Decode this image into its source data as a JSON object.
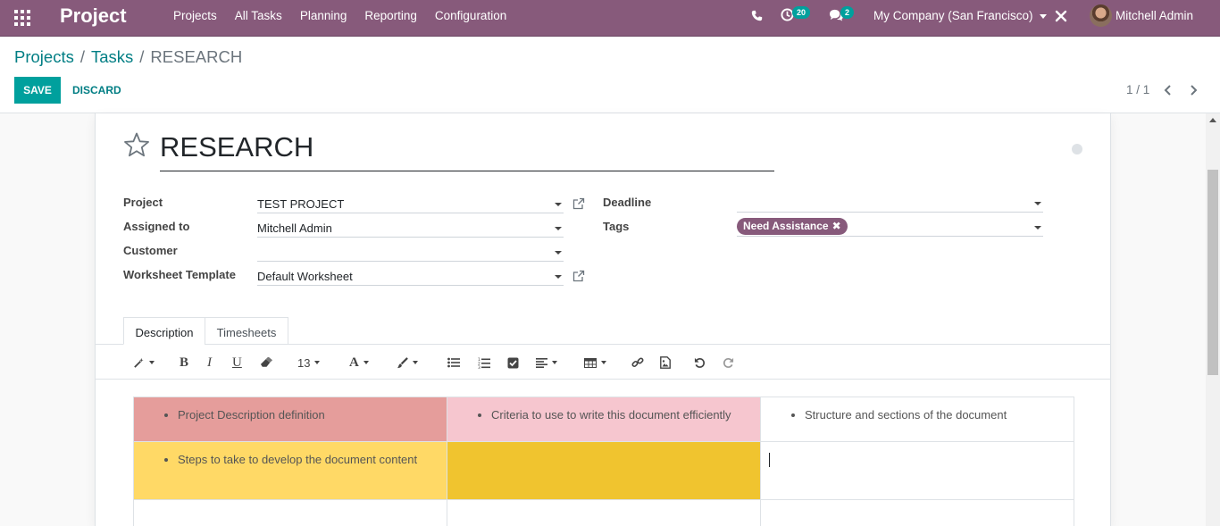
{
  "navbar": {
    "app_title": "Project",
    "menu": [
      "Projects",
      "All Tasks",
      "Planning",
      "Reporting",
      "Configuration"
    ],
    "activity_count": "20",
    "messages_count": "2",
    "company": "My Company (San Francisco)",
    "user": "Mitchell Admin",
    "color": "#875a7b"
  },
  "breadcrumb": {
    "projects": "Projects",
    "tasks": "Tasks",
    "current": "RESEARCH"
  },
  "buttons": {
    "save": "SAVE",
    "discard": "DISCARD"
  },
  "pager": {
    "value": "1 / 1"
  },
  "task": {
    "name": "RESEARCH",
    "labels": {
      "project": "Project",
      "assigned_to": "Assigned to",
      "customer": "Customer",
      "worksheet_template": "Worksheet Template",
      "deadline": "Deadline",
      "tags": "Tags"
    },
    "values": {
      "project": "TEST PROJECT",
      "assigned_to": "Mitchell Admin",
      "customer": "",
      "worksheet_template": "Default Worksheet",
      "deadline": "",
      "tag": "Need Assistance"
    }
  },
  "tabs": [
    "Description",
    "Timesheets"
  ],
  "toolbar": {
    "font_size": "13"
  },
  "description_table": {
    "rows": [
      [
        "Project Description definition",
        "Criteria to use to write this document efficiently",
        "Structure and sections of the document"
      ],
      [
        "Steps to take to develop the document content",
        "",
        ""
      ],
      [
        "",
        "",
        ""
      ]
    ],
    "cell_colors": [
      [
        "#e59d9b",
        "#f6c6cf",
        "#ffffff"
      ],
      [
        "#ffd966",
        "#f0c42f",
        "#ffffff"
      ],
      [
        "#ffffff",
        "#ffffff",
        "#ffffff"
      ]
    ]
  }
}
